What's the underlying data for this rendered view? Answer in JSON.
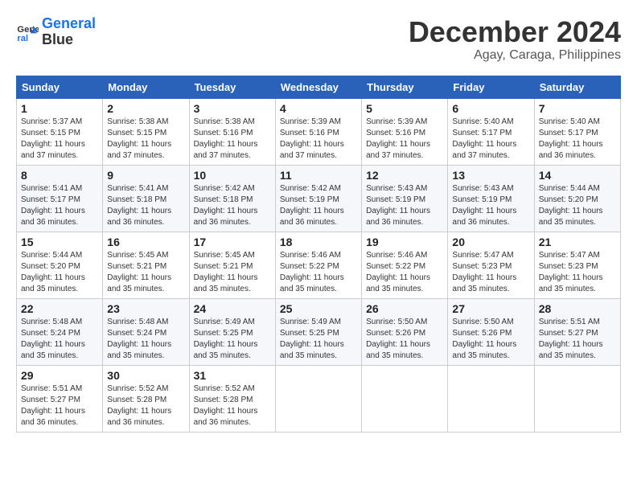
{
  "header": {
    "logo_line1": "General",
    "logo_line2": "Blue",
    "title": "December 2024",
    "subtitle": "Agay, Caraga, Philippines"
  },
  "weekdays": [
    "Sunday",
    "Monday",
    "Tuesday",
    "Wednesday",
    "Thursday",
    "Friday",
    "Saturday"
  ],
  "weeks": [
    [
      {
        "day": "1",
        "sunrise": "5:37 AM",
        "sunset": "5:15 PM",
        "daylight": "11 hours and 37 minutes."
      },
      {
        "day": "2",
        "sunrise": "5:38 AM",
        "sunset": "5:15 PM",
        "daylight": "11 hours and 37 minutes."
      },
      {
        "day": "3",
        "sunrise": "5:38 AM",
        "sunset": "5:16 PM",
        "daylight": "11 hours and 37 minutes."
      },
      {
        "day": "4",
        "sunrise": "5:39 AM",
        "sunset": "5:16 PM",
        "daylight": "11 hours and 37 minutes."
      },
      {
        "day": "5",
        "sunrise": "5:39 AM",
        "sunset": "5:16 PM",
        "daylight": "11 hours and 37 minutes."
      },
      {
        "day": "6",
        "sunrise": "5:40 AM",
        "sunset": "5:17 PM",
        "daylight": "11 hours and 37 minutes."
      },
      {
        "day": "7",
        "sunrise": "5:40 AM",
        "sunset": "5:17 PM",
        "daylight": "11 hours and 36 minutes."
      }
    ],
    [
      {
        "day": "8",
        "sunrise": "5:41 AM",
        "sunset": "5:17 PM",
        "daylight": "11 hours and 36 minutes."
      },
      {
        "day": "9",
        "sunrise": "5:41 AM",
        "sunset": "5:18 PM",
        "daylight": "11 hours and 36 minutes."
      },
      {
        "day": "10",
        "sunrise": "5:42 AM",
        "sunset": "5:18 PM",
        "daylight": "11 hours and 36 minutes."
      },
      {
        "day": "11",
        "sunrise": "5:42 AM",
        "sunset": "5:19 PM",
        "daylight": "11 hours and 36 minutes."
      },
      {
        "day": "12",
        "sunrise": "5:43 AM",
        "sunset": "5:19 PM",
        "daylight": "11 hours and 36 minutes."
      },
      {
        "day": "13",
        "sunrise": "5:43 AM",
        "sunset": "5:19 PM",
        "daylight": "11 hours and 36 minutes."
      },
      {
        "day": "14",
        "sunrise": "5:44 AM",
        "sunset": "5:20 PM",
        "daylight": "11 hours and 35 minutes."
      }
    ],
    [
      {
        "day": "15",
        "sunrise": "5:44 AM",
        "sunset": "5:20 PM",
        "daylight": "11 hours and 35 minutes."
      },
      {
        "day": "16",
        "sunrise": "5:45 AM",
        "sunset": "5:21 PM",
        "daylight": "11 hours and 35 minutes."
      },
      {
        "day": "17",
        "sunrise": "5:45 AM",
        "sunset": "5:21 PM",
        "daylight": "11 hours and 35 minutes."
      },
      {
        "day": "18",
        "sunrise": "5:46 AM",
        "sunset": "5:22 PM",
        "daylight": "11 hours and 35 minutes."
      },
      {
        "day": "19",
        "sunrise": "5:46 AM",
        "sunset": "5:22 PM",
        "daylight": "11 hours and 35 minutes."
      },
      {
        "day": "20",
        "sunrise": "5:47 AM",
        "sunset": "5:23 PM",
        "daylight": "11 hours and 35 minutes."
      },
      {
        "day": "21",
        "sunrise": "5:47 AM",
        "sunset": "5:23 PM",
        "daylight": "11 hours and 35 minutes."
      }
    ],
    [
      {
        "day": "22",
        "sunrise": "5:48 AM",
        "sunset": "5:24 PM",
        "daylight": "11 hours and 35 minutes."
      },
      {
        "day": "23",
        "sunrise": "5:48 AM",
        "sunset": "5:24 PM",
        "daylight": "11 hours and 35 minutes."
      },
      {
        "day": "24",
        "sunrise": "5:49 AM",
        "sunset": "5:25 PM",
        "daylight": "11 hours and 35 minutes."
      },
      {
        "day": "25",
        "sunrise": "5:49 AM",
        "sunset": "5:25 PM",
        "daylight": "11 hours and 35 minutes."
      },
      {
        "day": "26",
        "sunrise": "5:50 AM",
        "sunset": "5:26 PM",
        "daylight": "11 hours and 35 minutes."
      },
      {
        "day": "27",
        "sunrise": "5:50 AM",
        "sunset": "5:26 PM",
        "daylight": "11 hours and 35 minutes."
      },
      {
        "day": "28",
        "sunrise": "5:51 AM",
        "sunset": "5:27 PM",
        "daylight": "11 hours and 35 minutes."
      }
    ],
    [
      {
        "day": "29",
        "sunrise": "5:51 AM",
        "sunset": "5:27 PM",
        "daylight": "11 hours and 36 minutes."
      },
      {
        "day": "30",
        "sunrise": "5:52 AM",
        "sunset": "5:28 PM",
        "daylight": "11 hours and 36 minutes."
      },
      {
        "day": "31",
        "sunrise": "5:52 AM",
        "sunset": "5:28 PM",
        "daylight": "11 hours and 36 minutes."
      },
      null,
      null,
      null,
      null
    ]
  ],
  "labels": {
    "sunrise": "Sunrise:",
    "sunset": "Sunset:",
    "daylight": "Daylight:"
  }
}
